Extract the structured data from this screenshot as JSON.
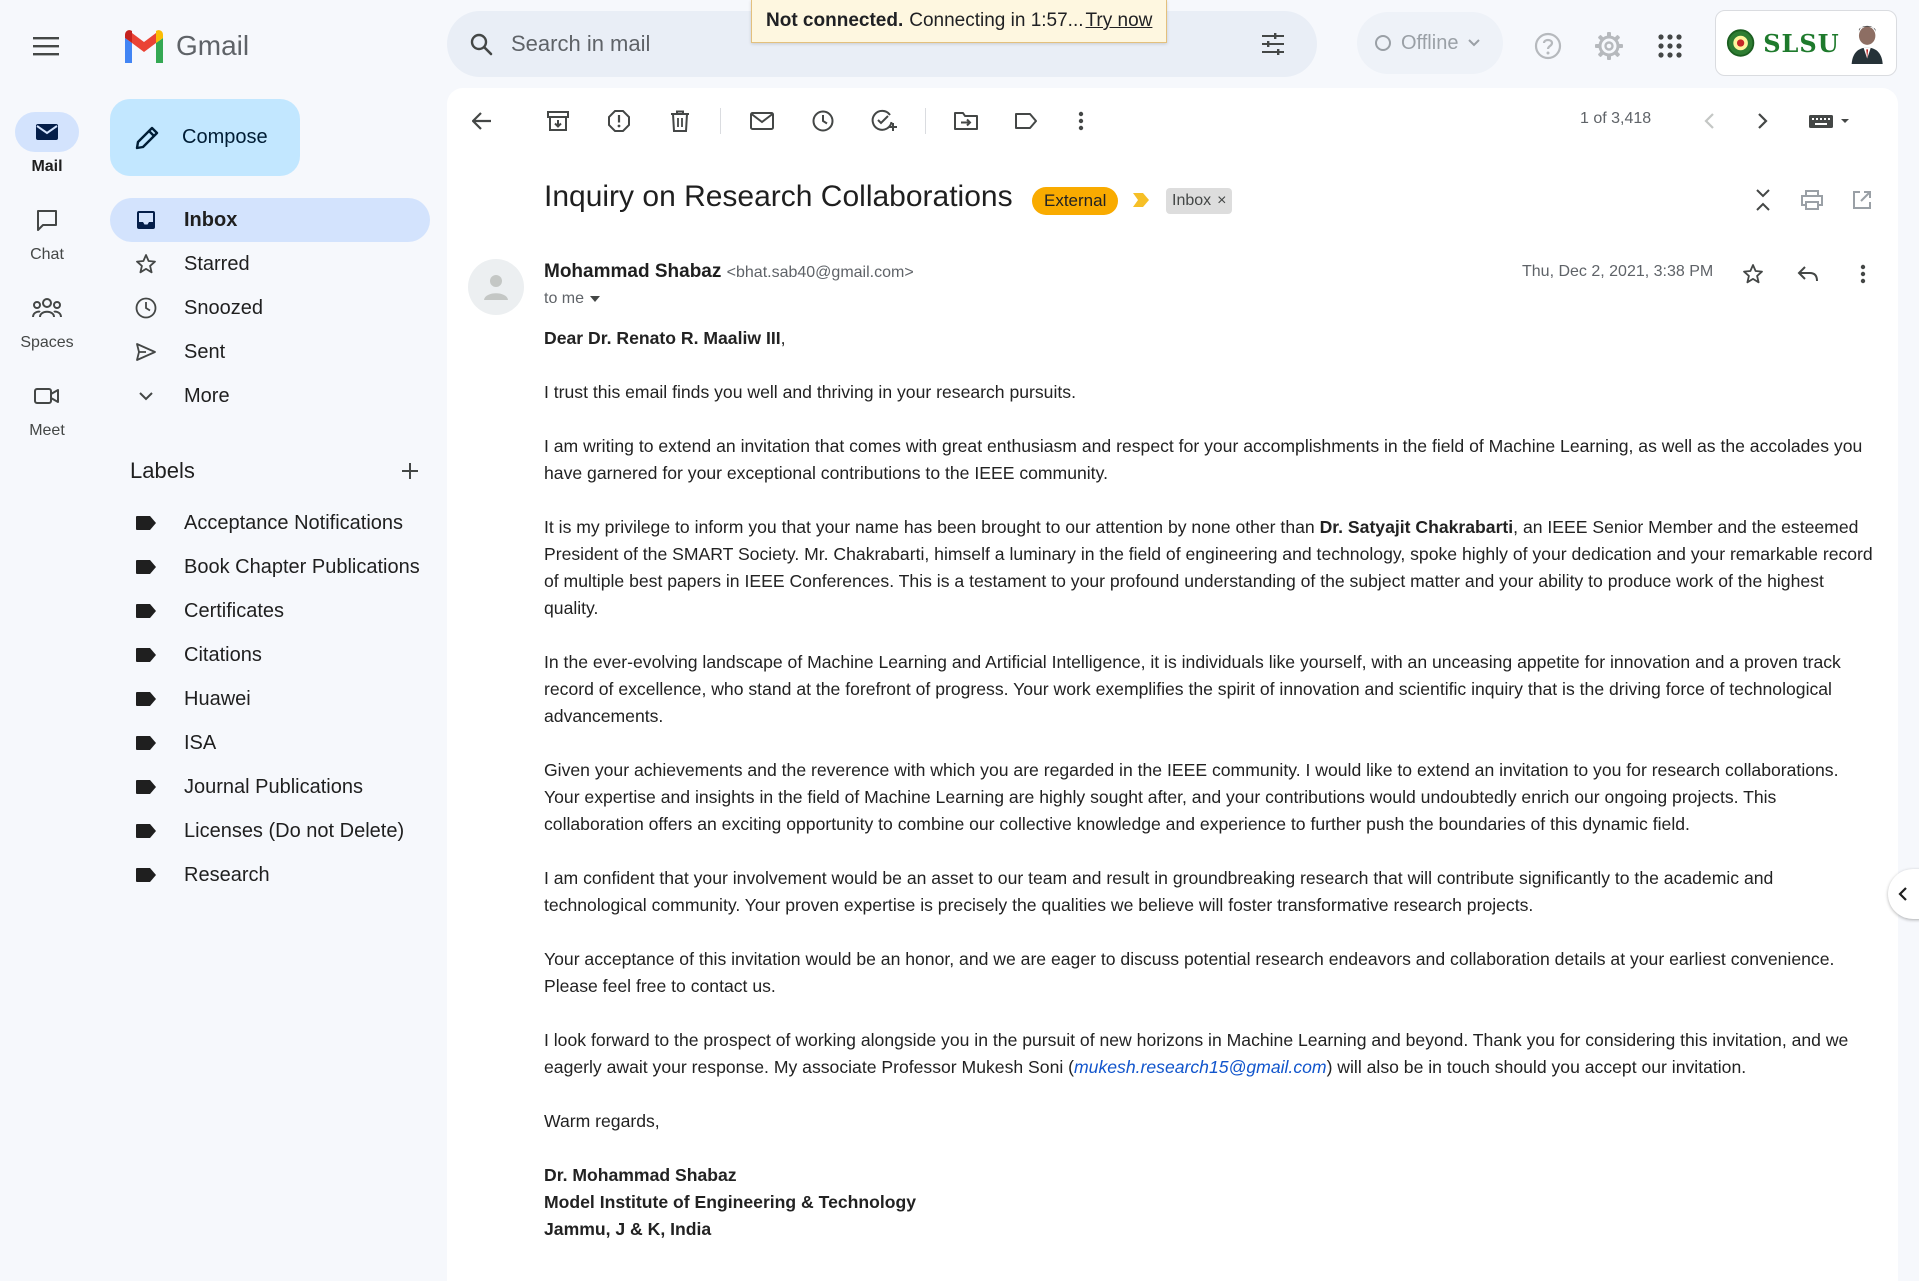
{
  "app": {
    "name": "Gmail"
  },
  "search": {
    "placeholder": "Search in mail"
  },
  "connection": {
    "status": "Not connected.",
    "message": "Connecting in 1:57...",
    "action": "Try now"
  },
  "status": {
    "offline_label": "Offline"
  },
  "account": {
    "org_label": "SLSU"
  },
  "rail": {
    "items": [
      {
        "label": "Mail",
        "icon": "mail-icon",
        "active": true
      },
      {
        "label": "Chat",
        "icon": "chat-icon",
        "active": false
      },
      {
        "label": "Spaces",
        "icon": "spaces-icon",
        "active": false
      },
      {
        "label": "Meet",
        "icon": "meet-icon",
        "active": false
      }
    ]
  },
  "compose": {
    "label": "Compose"
  },
  "nav": {
    "items": [
      {
        "label": "Inbox",
        "icon": "inbox-icon",
        "active": true
      },
      {
        "label": "Starred",
        "icon": "star-icon"
      },
      {
        "label": "Snoozed",
        "icon": "clock-icon"
      },
      {
        "label": "Sent",
        "icon": "send-icon"
      },
      {
        "label": "More",
        "icon": "chevron-down-icon"
      }
    ]
  },
  "labels": {
    "heading": "Labels",
    "items": [
      "Acceptance Notifications",
      "Book Chapter Publications",
      "Certificates",
      "Citations",
      "Huawei",
      "ISA",
      "Journal Publications",
      "Licenses (Do not Delete)",
      "Research"
    ]
  },
  "toolbar": {
    "pager": "1 of 3,418"
  },
  "email": {
    "subject": "Inquiry on Research Collaborations",
    "external_badge": "External",
    "inbox_badge": "Inbox",
    "inbox_badge_remove": "×",
    "sender_name": "Mohammad Shabaz",
    "sender_email": "<bhat.sab40@gmail.com>",
    "recipient": "to me",
    "date": "Thu, Dec 2, 2021, 3:38 PM",
    "greeting_prefix": "Dear Dr. Renato R. Maaliw III",
    "greeting_suffix": ",",
    "p1": "I trust this email finds you well and thriving in your research pursuits.",
    "p2": "I am writing to extend an invitation that comes with great enthusiasm and respect for your accomplishments in the field of Machine Learning, as well as the accolades you have garnered for your exceptional contributions to the IEEE community.",
    "p3_before": "It is my privilege to inform you that your name has been brought to our attention by none other than ",
    "p3_bold": "Dr. Satyajit Chakrabarti",
    "p3_after": ", an IEEE Senior Member and the esteemed President of the SMART Society. Mr. Chakrabarti, himself a luminary in the field of engineering and technology, spoke highly of your dedication and your remarkable record of multiple best papers in IEEE Conferences. This is a testament to your profound understanding of the subject matter and your ability to produce work of the highest quality.",
    "p4": "In the ever-evolving landscape of Machine Learning and Artificial Intelligence, it is individuals like yourself, with an unceasing appetite for innovation and a proven track record of excellence, who stand at the forefront of progress. Your work exemplifies the spirit of innovation and scientific inquiry that is the driving force of technological advancements.",
    "p5": "Given your achievements and the reverence with which you are regarded in the IEEE community. I would like to extend an invitation to you for research collaborations. Your expertise and insights in the field of Machine Learning are highly sought after, and your contributions would undoubtedly enrich our ongoing projects. This collaboration offers an exciting opportunity to combine our collective knowledge and experience to further push the boundaries of this dynamic field.",
    "p6": "I am confident that your involvement would be an asset to our team and result in groundbreaking research that will contribute significantly to the academic and technological community. Your proven expertise is precisely the qualities we believe will foster transformative research projects.",
    "p7": "Your acceptance of this invitation would be an honor, and we are eager to discuss potential research endeavors and collaboration details at your earliest convenience. Please feel free to contact us.",
    "p8_before": "I look forward to the prospect of working alongside you in the pursuit of new horizons in Machine Learning and beyond. Thank you for considering this invitation, and we eagerly await your response. My associate Professor Mukesh Soni (",
    "p8_link": "mukesh.research15@gmail.com",
    "p8_after": ") will also be in touch should you accept our invitation.",
    "closing": "Warm regards,",
    "sig_name": "Dr. Mohammad Shabaz",
    "sig_org": "Model Institute of Engineering & Technology",
    "sig_loc": "Jammu, J & K, India"
  },
  "colors": {
    "accent": "#0b57d0",
    "active_bg": "#d3e3fd",
    "compose_bg": "#c2e7ff",
    "external_badge": "#f9ab00",
    "page_bg": "#f6f8fc"
  }
}
